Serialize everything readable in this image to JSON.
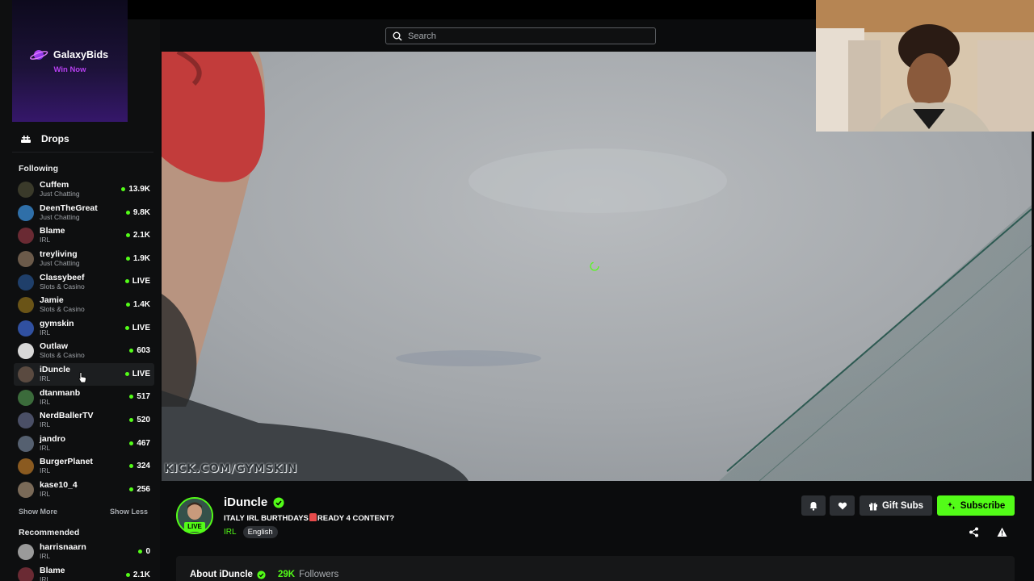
{
  "ad": {
    "brand": "GalaxyBids",
    "tagline": "Win Now"
  },
  "nav": {
    "drops_label": "Drops"
  },
  "search": {
    "placeholder": "Search"
  },
  "following": {
    "title": "Following",
    "channels": [
      {
        "name": "Cuffem",
        "category": "Just Chatting",
        "viewers": "13.9K",
        "color": "#3a3a2a"
      },
      {
        "name": "DeenTheGreat",
        "category": "Just Chatting",
        "viewers": "9.8K",
        "color": "#2f6fa8"
      },
      {
        "name": "Blame",
        "category": "IRL",
        "viewers": "2.1K",
        "color": "#6a2a33"
      },
      {
        "name": "treyliving",
        "category": "Just Chatting",
        "viewers": "1.9K",
        "color": "#6b5a4a"
      },
      {
        "name": "Classybeef",
        "category": "Slots & Casino",
        "viewers": "LIVE",
        "color": "#1f3f6a"
      },
      {
        "name": "Jamie",
        "category": "Slots & Casino",
        "viewers": "1.4K",
        "color": "#6a5417"
      },
      {
        "name": "gymskin",
        "category": "IRL",
        "viewers": "LIVE",
        "color": "#3050a0"
      },
      {
        "name": "Outlaw",
        "category": "Slots & Casino",
        "viewers": "603",
        "color": "#d8d8d8"
      },
      {
        "name": "iDuncle",
        "category": "IRL",
        "viewers": "LIVE",
        "color": "#5a4a40"
      },
      {
        "name": "dtanmanb",
        "category": "IRL",
        "viewers": "517",
        "color": "#3b6b3b"
      },
      {
        "name": "NerdBallerTV",
        "category": "IRL",
        "viewers": "520",
        "color": "#4a4f66"
      },
      {
        "name": "jandro",
        "category": "IRL",
        "viewers": "467",
        "color": "#556070"
      },
      {
        "name": "BurgerPlanet",
        "category": "IRL",
        "viewers": "324",
        "color": "#8a5a20"
      },
      {
        "name": "kase10_4",
        "category": "IRL",
        "viewers": "256",
        "color": "#7a6a58"
      }
    ],
    "show_more": "Show More",
    "show_less": "Show Less"
  },
  "recommended": {
    "title": "Recommended",
    "channels": [
      {
        "name": "harrisnaarn",
        "category": "IRL",
        "viewers": "0",
        "color": "#9a9a9a"
      },
      {
        "name": "Blame",
        "category": "IRL",
        "viewers": "2.1K",
        "color": "#6a2a33"
      }
    ]
  },
  "video": {
    "watermark": "KICK.COM/GYMSKIN"
  },
  "stream": {
    "streamer": "iDuncle",
    "live_badge": "LIVE",
    "title_part1": "ITALY IRL BURTHDAYS",
    "title_part2": "READY 4 CONTENT?",
    "category": "IRL",
    "language": "English"
  },
  "actions": {
    "gift_label": "Gift Subs",
    "subscribe_label": "Subscribe"
  },
  "about": {
    "label": "About iDuncle",
    "followers_count": "29K",
    "followers_label": "Followers"
  },
  "colors": {
    "accent": "#53fc18",
    "background": "#0b0c0d",
    "button": "#2d3034"
  }
}
